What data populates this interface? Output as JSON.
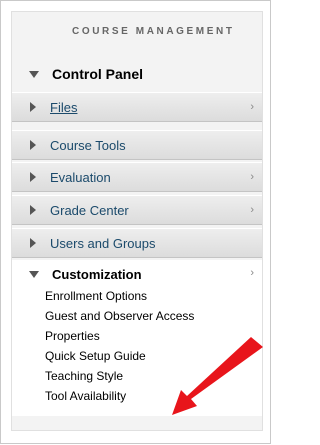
{
  "menu": {
    "heading": "COURSE MANAGEMENT",
    "control_panel": "Control Panel",
    "items": [
      {
        "label": "Files",
        "has_submenu": true,
        "link": true
      },
      {
        "label": "Course Tools",
        "has_submenu": false,
        "link": false
      },
      {
        "label": "Evaluation",
        "has_submenu": true,
        "link": false
      },
      {
        "label": "Grade Center",
        "has_submenu": true,
        "link": false
      },
      {
        "label": "Users and Groups",
        "has_submenu": false,
        "link": false
      }
    ],
    "customization": {
      "label": "Customization",
      "children": [
        "Enrollment Options",
        "Guest and Observer Access",
        "Properties",
        "Quick Setup Guide",
        "Teaching Style",
        "Tool Availability"
      ]
    }
  },
  "colors": {
    "annotation_arrow": "#e8151b",
    "link_text": "#1b4a6b"
  },
  "icons": {
    "expanded": "triangle-down-icon",
    "collapsed": "triangle-right-icon",
    "submenu": "chevron-right-icon",
    "annotation": "red-arrow-icon"
  }
}
